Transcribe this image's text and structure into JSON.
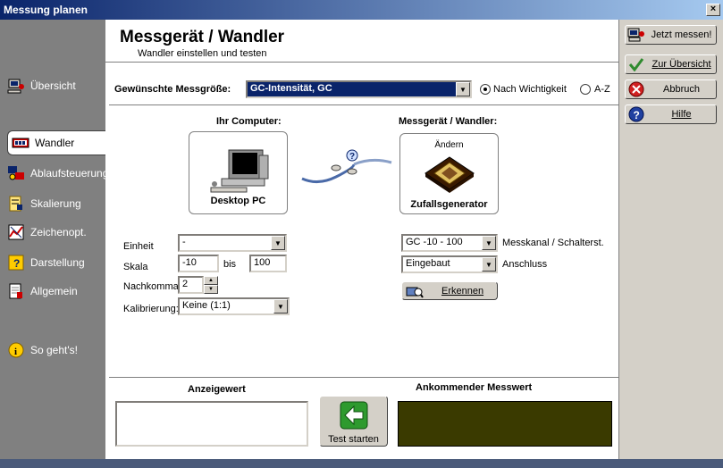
{
  "window": {
    "title": "Messung planen",
    "close_label": "×"
  },
  "header": {
    "title": "Messgerät / Wandler",
    "subtitle": "Wandler einstellen und testen"
  },
  "sidebar": {
    "items": [
      {
        "label": "Übersicht",
        "icon": "overview-icon"
      },
      {
        "label": "Wandler",
        "icon": "converter-icon",
        "active": true
      },
      {
        "label": "Ablaufsteuerung",
        "icon": "flow-control-icon"
      },
      {
        "label": "Skalierung",
        "icon": "scaling-icon"
      },
      {
        "label": "Zeichenopt.",
        "icon": "drawing-options-icon"
      },
      {
        "label": "Darstellung",
        "icon": "display-icon"
      },
      {
        "label": "Allgemein",
        "icon": "general-icon"
      },
      {
        "label": "So geht's!",
        "icon": "info-icon"
      }
    ]
  },
  "right_buttons": {
    "measure_now": "Jetzt messen!",
    "overview": "Zur Übersicht",
    "cancel": "Abbruch",
    "help": "Hilfe"
  },
  "quantity": {
    "label": "Gewünschte Messgröße:",
    "selected": "GC-Intensität, GC",
    "sort_importance": "Nach Wichtigkeit",
    "sort_az": "A-Z",
    "sort_selected": "importance"
  },
  "computer": {
    "heading": "Ihr Computer:",
    "name": "Desktop PC"
  },
  "device": {
    "heading": "Messgerät / Wandler:",
    "change_label": "Ändern",
    "name": "Zufallsgenerator"
  },
  "left_settings": {
    "unit_label": "Einheit",
    "unit_value": "-",
    "scale_label": "Skala",
    "scale_from": "-10",
    "scale_to_label": "bis",
    "scale_to": "100",
    "decimals_label": "Nachkomma",
    "decimals_value": "2",
    "calibration_label": "Kalibrierung:",
    "calibration_value": "Keine (1:1)"
  },
  "right_settings": {
    "channel_value": "GC -10 - 100",
    "channel_label": "Messkanal / Schalterst.",
    "connection_value": "Eingebaut",
    "connection_label": "Anschluss",
    "detect_label": "Erkennen"
  },
  "test": {
    "display_label": "Anzeigewert",
    "incoming_label": "Ankommender Messwert",
    "start_label": "Test starten"
  },
  "colors": {
    "titlebar_start": "#0a246a",
    "titlebar_end": "#a6caf0",
    "selection": "#0a246a",
    "incoming_bg": "#3a3a00"
  }
}
